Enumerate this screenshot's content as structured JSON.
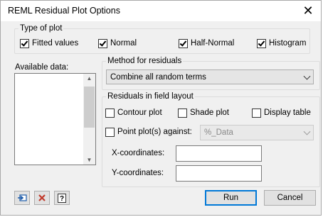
{
  "window": {
    "title": "REML Residual Plot Options",
    "close_glyph": "✕"
  },
  "type_of_plot": {
    "legend": "Type of plot",
    "options": [
      {
        "label": "Fitted values",
        "checked": true
      },
      {
        "label": "Normal",
        "checked": true
      },
      {
        "label": "Half-Normal",
        "checked": true
      },
      {
        "label": "Histogram",
        "checked": true
      }
    ]
  },
  "available_data": {
    "label": "Available data:",
    "items": []
  },
  "method": {
    "legend": "Method for residuals",
    "selected": "Combine all random terms"
  },
  "field_layout": {
    "legend": "Residuals in field layout",
    "contour_plot": {
      "label": "Contour plot",
      "checked": false
    },
    "shade_plot": {
      "label": "Shade plot",
      "checked": false
    },
    "display_table": {
      "label": "Display table",
      "checked": false
    },
    "point_plots": {
      "label": "Point plot(s) against:",
      "checked": false
    },
    "point_plots_value": "%_Data",
    "x_coordinates": {
      "label": "X-coordinates:",
      "value": ""
    },
    "y_coordinates": {
      "label": "Y-coordinates:",
      "value": ""
    }
  },
  "buttons": {
    "run": "Run",
    "cancel": "Cancel"
  },
  "toolbar_icons": [
    "pin-icon",
    "clear-icon",
    "help-icon"
  ],
  "colors": {
    "dialog_bg": "#f0f0f0",
    "clear_icon": "#c0392b",
    "pin_icon": "#1c5aa8",
    "default_button_border": "#0078d7"
  }
}
